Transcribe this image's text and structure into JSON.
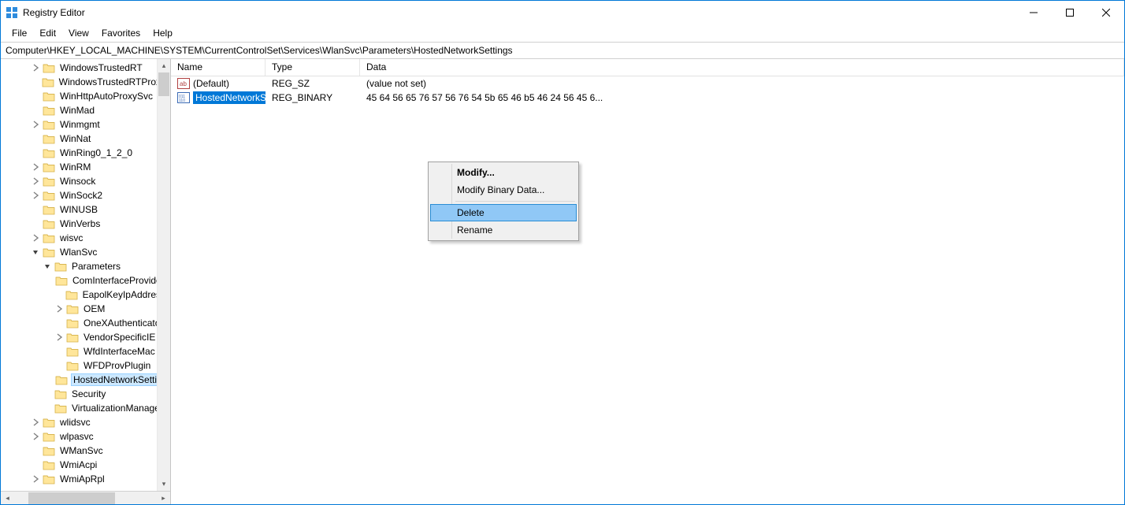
{
  "window": {
    "title": "Registry Editor"
  },
  "menu": {
    "file": "File",
    "edit": "Edit",
    "view": "View",
    "favorites": "Favorites",
    "help": "Help"
  },
  "address": "Computer\\HKEY_LOCAL_MACHINE\\SYSTEM\\CurrentControlSet\\Services\\WlanSvc\\Parameters\\HostedNetworkSettings",
  "tree": [
    {
      "indent": 3,
      "expander": "closed",
      "label": "WindowsTrustedRT"
    },
    {
      "indent": 3,
      "expander": "none",
      "label": "WindowsTrustedRTProxy"
    },
    {
      "indent": 3,
      "expander": "none",
      "label": "WinHttpAutoProxySvc"
    },
    {
      "indent": 3,
      "expander": "none",
      "label": "WinMad"
    },
    {
      "indent": 3,
      "expander": "closed",
      "label": "Winmgmt"
    },
    {
      "indent": 3,
      "expander": "none",
      "label": "WinNat"
    },
    {
      "indent": 3,
      "expander": "none",
      "label": "WinRing0_1_2_0"
    },
    {
      "indent": 3,
      "expander": "closed",
      "label": "WinRM"
    },
    {
      "indent": 3,
      "expander": "closed",
      "label": "Winsock"
    },
    {
      "indent": 3,
      "expander": "closed",
      "label": "WinSock2"
    },
    {
      "indent": 3,
      "expander": "none",
      "label": "WINUSB"
    },
    {
      "indent": 3,
      "expander": "none",
      "label": "WinVerbs"
    },
    {
      "indent": 3,
      "expander": "closed",
      "label": "wisvc"
    },
    {
      "indent": 3,
      "expander": "open",
      "label": "WlanSvc"
    },
    {
      "indent": 4,
      "expander": "open",
      "label": "Parameters"
    },
    {
      "indent": 5,
      "expander": "none",
      "label": "ComInterfaceProviders"
    },
    {
      "indent": 5,
      "expander": "none",
      "label": "EapolKeyIpAddress"
    },
    {
      "indent": 5,
      "expander": "closed",
      "label": "OEM"
    },
    {
      "indent": 5,
      "expander": "none",
      "label": "OneXAuthenticator"
    },
    {
      "indent": 5,
      "expander": "closed",
      "label": "VendorSpecificIE"
    },
    {
      "indent": 5,
      "expander": "none",
      "label": "WfdInterfaceMac"
    },
    {
      "indent": 5,
      "expander": "none",
      "label": "WFDProvPlugin"
    },
    {
      "indent": 5,
      "expander": "none",
      "label": "HostedNetworkSettings",
      "selected": true
    },
    {
      "indent": 4,
      "expander": "none",
      "label": "Security"
    },
    {
      "indent": 4,
      "expander": "none",
      "label": "VirtualizationManager"
    },
    {
      "indent": 3,
      "expander": "closed",
      "label": "wlidsvc"
    },
    {
      "indent": 3,
      "expander": "closed",
      "label": "wlpasvc"
    },
    {
      "indent": 3,
      "expander": "none",
      "label": "WManSvc"
    },
    {
      "indent": 3,
      "expander": "none",
      "label": "WmiAcpi"
    },
    {
      "indent": 3,
      "expander": "closed",
      "label": "WmiApRpl"
    }
  ],
  "list": {
    "headers": {
      "name": "Name",
      "type": "Type",
      "data": "Data"
    },
    "rows": [
      {
        "icon": "string",
        "name": "(Default)",
        "type": "REG_SZ",
        "data": "(value not set)",
        "selected": false
      },
      {
        "icon": "binary",
        "name": "HostedNetworkSettings",
        "type": "REG_BINARY",
        "data": "45 64 56 65 76 57 56 76 54 5b 65 46 b5 46 24 56 45 6...",
        "selected": true
      }
    ]
  },
  "contextmenu": {
    "modify": "Modify...",
    "modify_binary": "Modify Binary Data...",
    "delete": "Delete",
    "rename": "Rename"
  }
}
